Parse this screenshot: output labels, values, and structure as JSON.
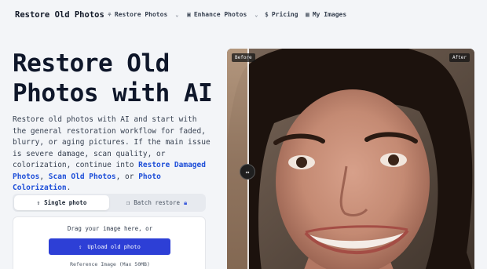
{
  "nav": {
    "brand": "Restore Old Photos",
    "items": [
      {
        "label": "Restore Photos",
        "icon": "wand-icon",
        "dropdown": true
      },
      {
        "label": "Enhance Photos",
        "icon": "image-enhance-icon",
        "dropdown": true
      },
      {
        "label": "Pricing",
        "icon": "dollar-icon",
        "dropdown": false
      },
      {
        "label": "My Images",
        "icon": "gallery-icon",
        "dropdown": false
      }
    ]
  },
  "hero": {
    "title": "Restore Old Photos with AI",
    "desc_start": "Restore old photos with AI and start with the general restoration workflow for faded, blurry, or aging pictures. If the main issue is severe damage, scan quality, or colorization, continue into ",
    "link1": "Restore Damaged Photos",
    "sep1": ", ",
    "link2": "Scan Old Photos",
    "sep2": ", or ",
    "link3": "Photo Colorization",
    "desc_end": "."
  },
  "tabs": {
    "single": "Single photo",
    "batch": "Batch restore"
  },
  "upload": {
    "drag_text": "Drag your image here, or",
    "button": "Upload old photo",
    "reference": "Reference Image (Max 50MB)"
  },
  "compare": {
    "before": "Before",
    "after": "After",
    "handle": "↔"
  },
  "colors": {
    "accent": "#2d3fd6",
    "link": "#1d4ed8",
    "background": "#f3f5f8"
  }
}
